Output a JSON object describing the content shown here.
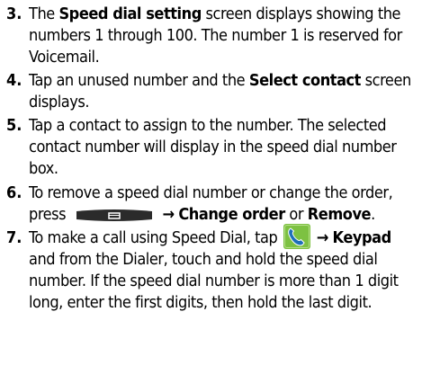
{
  "steps": [
    {
      "number": "3.",
      "parts": [
        {
          "t": "The "
        },
        {
          "b": "Speed dial setting"
        },
        {
          "t": " screen displays showing the numbers 1 through 100. The number 1 is reserved for Voicemail."
        }
      ]
    },
    {
      "number": "4.",
      "parts": [
        {
          "t": "Tap an unused number and the "
        },
        {
          "b": "Select contact"
        },
        {
          "t": " screen displays."
        }
      ]
    },
    {
      "number": "5.",
      "parts": [
        {
          "t": "Tap a contact to assign to the number. The selected contact number will display in the speed dial number box."
        }
      ]
    },
    {
      "number": "6.",
      "parts": [
        {
          "t": "To remove a speed dial number or change the order, press "
        },
        {
          "icon": "menu-key-icon"
        },
        {
          "t": " "
        },
        {
          "arrow": "→"
        },
        {
          "t": " "
        },
        {
          "b": "Change order"
        },
        {
          "t": " or "
        },
        {
          "b": "Remove"
        },
        {
          "t": "."
        }
      ]
    },
    {
      "number": "7.",
      "parts": [
        {
          "t": "To make a call using Speed Dial, tap "
        },
        {
          "icon": "phone-app-icon"
        },
        {
          "t": " "
        },
        {
          "arrow": "→"
        },
        {
          "t": " "
        },
        {
          "b": "Keypad"
        },
        {
          "t": " and from the Dialer, touch and hold the speed dial number. If the speed dial number is more than 1 digit long, enter the first digits, then hold the last digit."
        }
      ]
    }
  ],
  "colors": {
    "text": "#000000",
    "menu_key": "#2b2b2b",
    "phone_icon_bg": "#7dc142",
    "phone_handset": "#1e6fb8"
  }
}
